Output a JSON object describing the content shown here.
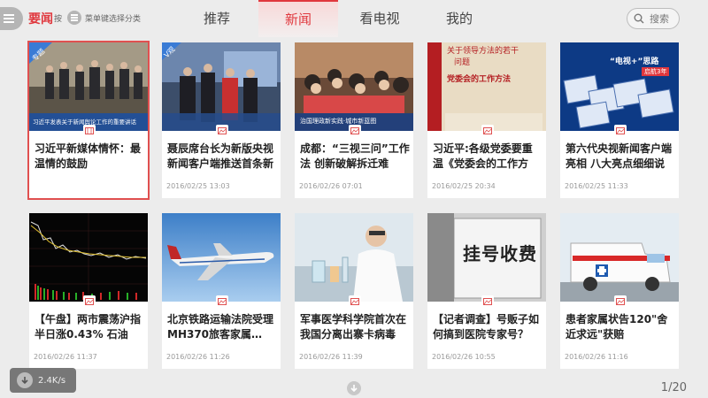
{
  "header": {
    "category": "要闻",
    "press_text": "按",
    "hint": "菜单键选择分类",
    "tabs": [
      "推荐",
      "新闻",
      "看电视",
      "我的"
    ],
    "active_tab": "新闻",
    "search_label": "搜索"
  },
  "cards": [
    {
      "title": "习近平新媒体情怀：最温情的鼓励",
      "date": "",
      "thumb_caption": "习近平发表关于新闻舆论工作的重要讲话",
      "tag": "专题"
    },
    {
      "title": "聂辰席台长为新版央视新闻客户端推送首条新",
      "date": "2016/02/25 13:03",
      "tag": "V观"
    },
    {
      "title": "成都：“三视三问”工作法 创新破解拆迁难",
      "date": "2016/02/26 07:01",
      "thumb_caption": "治国理政新实践·城市新蓝图"
    },
    {
      "title": "习近平:各级党委要重温《党委会的工作方",
      "date": "2016/02/25 20:34",
      "thumb_text": [
        "关于领导方法的若干",
        "问题",
        "党委会的工作方法"
      ]
    },
    {
      "title": "第六代央视新闻客户端亮相 八大亮点细细说",
      "date": "2016/02/25 11:33",
      "thumb_text": [
        "“电视+”思路",
        "启航3年"
      ]
    },
    {
      "title": "【午盘】两市震荡沪指半日涨0.43% 石油板…",
      "date": "2016/02/26 11:37"
    },
    {
      "title": "北京铁路运输法院受理MH370旅客家属…",
      "date": "2016/02/26 11:26"
    },
    {
      "title": "军事医学科学院首次在我国分离出寨卡病毒",
      "date": "2016/02/26 11:39"
    },
    {
      "title": "【记者调查】号贩子如何搞到医院专家号？",
      "date": "2016/02/26 10:55",
      "thumb_text": [
        "挂号收费"
      ]
    },
    {
      "title": "患者家属状告120\"舍近求远\"获赔",
      "date": "2016/02/26 11:16"
    }
  ],
  "footer": {
    "speed": "2.4K/s",
    "page": "1/20"
  }
}
